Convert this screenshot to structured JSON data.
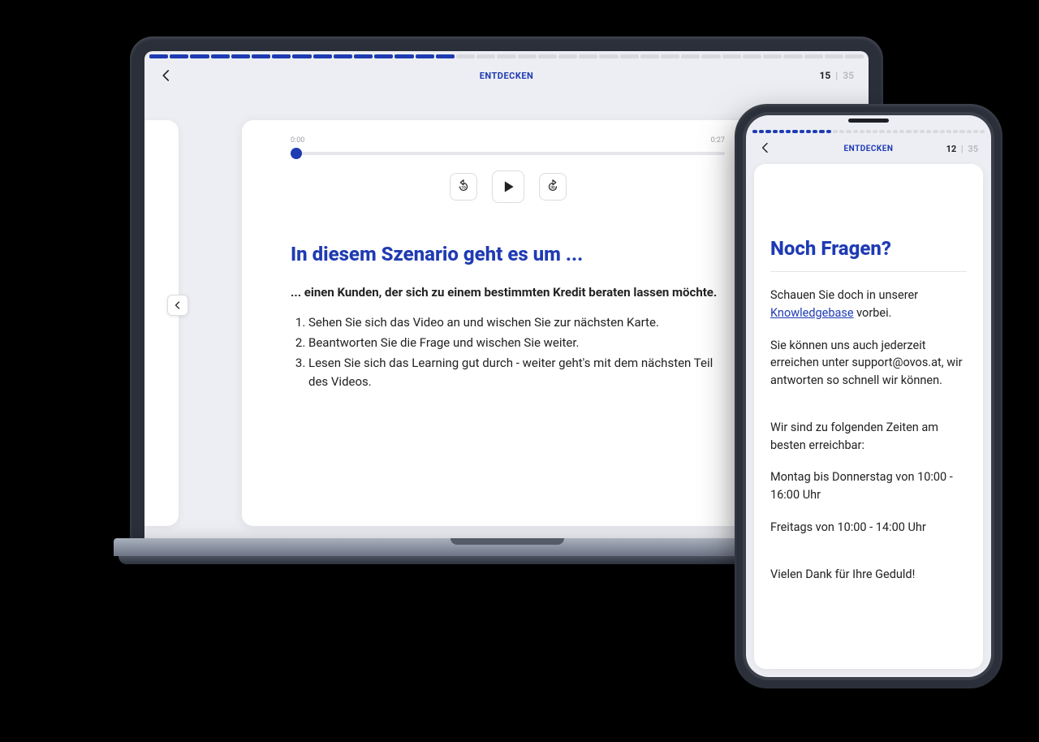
{
  "colors": {
    "accent": "#1f3bb3",
    "bg": "#eceef3"
  },
  "laptop": {
    "header": {
      "title": "ENTDECKEN",
      "current_page": "15",
      "total_pages": "35",
      "progress_done": 15,
      "progress_total": 35
    },
    "player": {
      "time_current": "0:00",
      "time_total": "0:27",
      "rewind_seconds": "10",
      "forward_seconds": "30"
    },
    "content": {
      "heading": "In diesem Szenario geht es um ...",
      "lead": "... einen Kunden, der sich zu einem bestimmten Kredit beraten lassen möchte.",
      "steps": [
        "Sehen Sie sich das Video an und wischen Sie zur nächsten Karte.",
        "Beantworten Sie die Frage und wischen Sie weiter.",
        "Lesen Sie sich das Learning gut durch - weiter geht's mit dem nächsten Teil des Videos."
      ]
    }
  },
  "phone": {
    "header": {
      "title": "ENTDECKEN",
      "current_page": "12",
      "total_pages": "35",
      "progress_done": 12,
      "progress_total": 35
    },
    "content": {
      "heading": "Noch Fragen?",
      "p1_prefix": "Schauen Sie doch in unserer ",
      "p1_link": "Knowledgebase",
      "p1_suffix": " vorbei.",
      "p2": "Sie können uns auch jederzeit erreichen unter support@ovos.at, wir antworten so schnell wir können.",
      "p3": "Wir sind zu folgenden Zeiten am besten erreichbar:",
      "p4": "Montag bis Donnerstag von 10:00 - 16:00 Uhr",
      "p5": "Freitags von 10:00 - 14:00 Uhr",
      "p6": "Vielen Dank für Ihre Geduld!"
    }
  }
}
